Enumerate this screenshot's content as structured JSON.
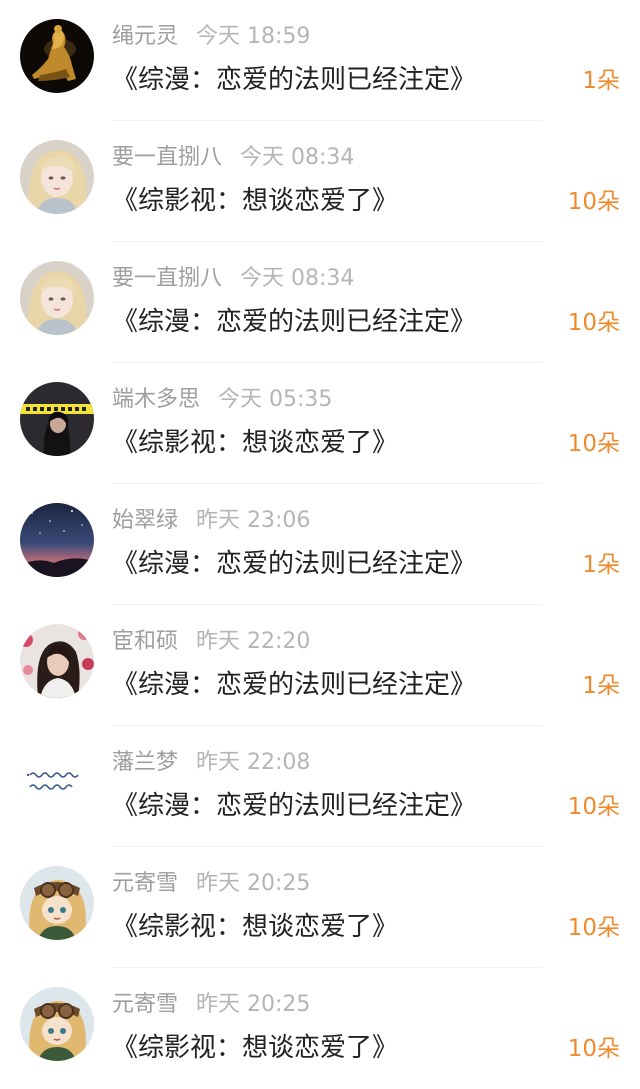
{
  "colors": {
    "name": "#9e9e9e",
    "time": "#b5b5b5",
    "title": "#222222",
    "gift": "#ef8b2e",
    "divider": "#f0f0f0"
  },
  "rows": [
    {
      "avatar": "avatar-golden-statue",
      "name": "绳元灵",
      "time": "今天 18:59",
      "title": "《综漫：恋爱的法则已经注定》",
      "gift": "1朵"
    },
    {
      "avatar": "avatar-illustrated-girl",
      "name": "要一直捌八",
      "time": "今天 08:34",
      "title": "《综影视：想谈恋爱了》",
      "gift": "10朵"
    },
    {
      "avatar": "avatar-illustrated-girl",
      "name": "要一直捌八",
      "time": "今天 08:34",
      "title": "《综漫：恋爱的法则已经注定》",
      "gift": "10朵"
    },
    {
      "avatar": "avatar-dark-portrait",
      "name": "端木多思",
      "time": "今天 05:35",
      "title": "《综影视：想谈恋爱了》",
      "gift": "10朵"
    },
    {
      "avatar": "avatar-night-sky",
      "name": "始翠绿",
      "time": "昨天 23:06",
      "title": "《综漫：恋爱的法则已经注定》",
      "gift": "1朵"
    },
    {
      "avatar": "avatar-girl-flowers",
      "name": "宦和硕",
      "time": "昨天 22:20",
      "title": "《综漫：恋爱的法则已经注定》",
      "gift": "1朵"
    },
    {
      "avatar": "avatar-handwriting",
      "name": "藩兰梦",
      "time": "昨天 22:08",
      "title": "《综漫：恋爱的法则已经注定》",
      "gift": "10朵"
    },
    {
      "avatar": "avatar-anime-goggles",
      "name": "元寄雪",
      "time": "昨天 20:25",
      "title": "《综影视：想谈恋爱了》",
      "gift": "10朵"
    },
    {
      "avatar": "avatar-anime-goggles",
      "name": "元寄雪",
      "time": "昨天 20:25",
      "title": "《综影视：想谈恋爱了》",
      "gift": "10朵"
    }
  ]
}
